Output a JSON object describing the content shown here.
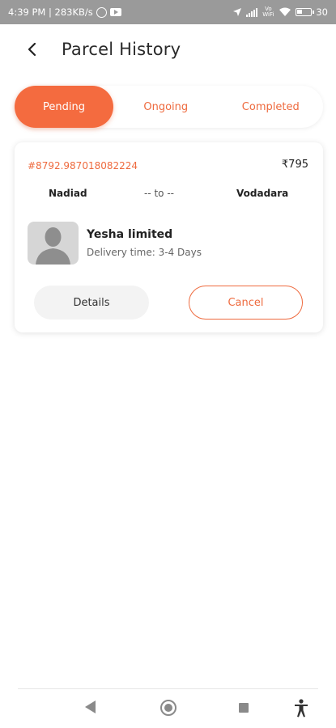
{
  "status_bar": {
    "time_info": "4:39 PM | 283KB/s",
    "network_label": "Vo WiFi",
    "battery": "30"
  },
  "header": {
    "title": "Parcel History",
    "back_icon": "chevron-left-icon"
  },
  "tabs": [
    {
      "label": "Pending",
      "active": true
    },
    {
      "label": "Ongoing",
      "active": false
    },
    {
      "label": "Completed",
      "active": false
    }
  ],
  "parcel": {
    "order_id": "#8792.987018082224",
    "price": "₹795",
    "from": "Nadiad",
    "separator": "-- to --",
    "to": "Vodadara",
    "company": "Yesha limited",
    "delivery_time": "Delivery time: 3-4 Days",
    "details_label": "Details",
    "cancel_label": "Cancel"
  },
  "colors": {
    "accent": "#f46b3f",
    "accent_text": "#ee6a3e",
    "status_bar": "#9a9a9a"
  },
  "nav_bar": {
    "icons": [
      "back-triangle-icon",
      "home-circle-icon",
      "recents-square-icon",
      "accessibility-icon"
    ]
  }
}
